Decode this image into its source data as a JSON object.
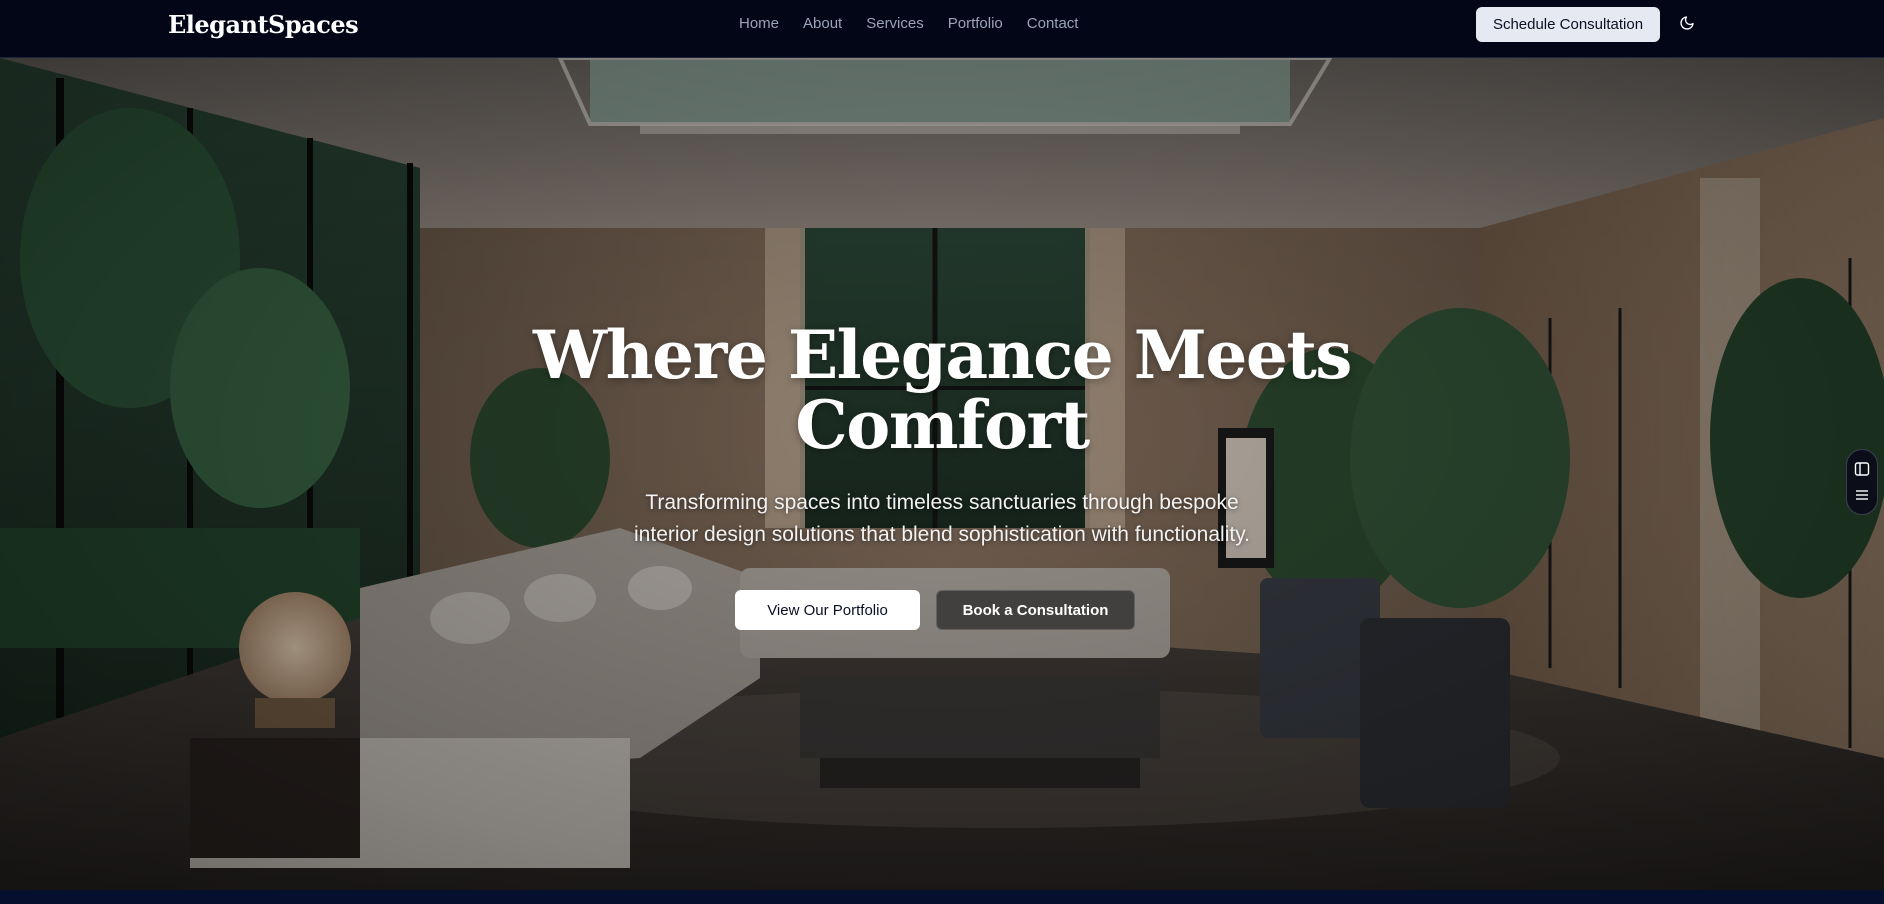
{
  "nav": {
    "brand": "ElegantSpaces",
    "links": [
      {
        "label": "Home"
      },
      {
        "label": "About"
      },
      {
        "label": "Services"
      },
      {
        "label": "Portfolio"
      },
      {
        "label": "Contact"
      }
    ],
    "cta_label": "Schedule Consultation",
    "theme_icon": "moon-icon"
  },
  "hero": {
    "title_line1": "Where Elegance Meets",
    "title_line2": "Comfort",
    "subtitle_line1": "Transforming spaces into timeless sanctuaries through bespoke",
    "subtitle_line2": "interior design solutions that blend sophistication with functionality.",
    "primary_button": "View Our Portfolio",
    "secondary_button": "Book a Consultation",
    "background_image": "luxury living room interior with floor-to-ceiling windows, sectional sofa, plants"
  },
  "side_dock": {
    "icons": [
      "sidebar-panel-icon",
      "menu-lines-icon"
    ]
  },
  "colors": {
    "nav_bg": "#030617",
    "cta_bg": "#e6e9f1",
    "text_primary": "#ffffff",
    "nav_link": "#9aa3b8",
    "secondary_button_bg": "#323232"
  }
}
